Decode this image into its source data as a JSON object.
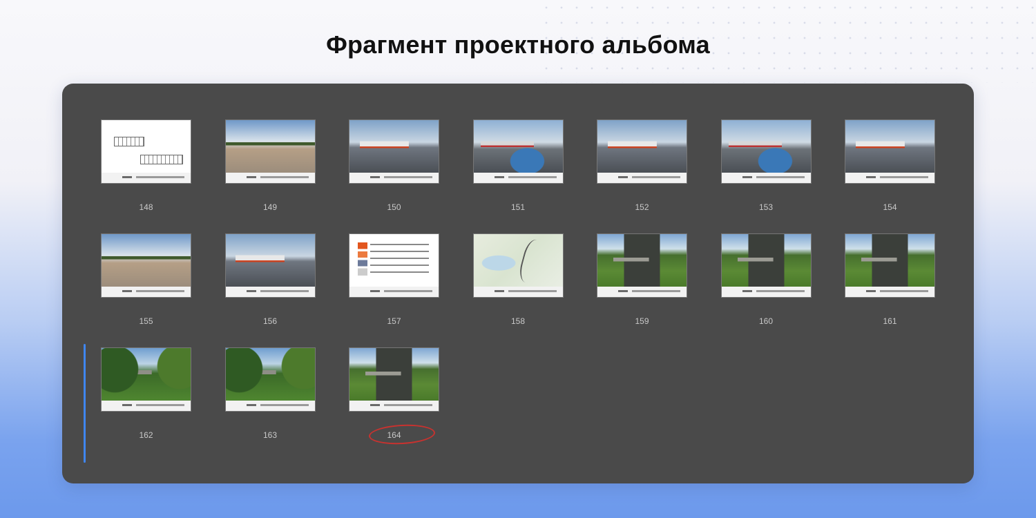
{
  "page_title": "Фрагмент проектного альбома",
  "album": {
    "pages": [
      {
        "label": "148",
        "thumb": "doc"
      },
      {
        "label": "149",
        "thumb": "lot"
      },
      {
        "label": "150",
        "thumb": "station"
      },
      {
        "label": "151",
        "thumb": "water"
      },
      {
        "label": "152",
        "thumb": "station"
      },
      {
        "label": "153",
        "thumb": "water"
      },
      {
        "label": "154",
        "thumb": "station"
      },
      {
        "label": "155",
        "thumb": "lot"
      },
      {
        "label": "156",
        "thumb": "station"
      },
      {
        "label": "157",
        "thumb": "legend"
      },
      {
        "label": "158",
        "thumb": "map"
      },
      {
        "label": "159",
        "thumb": "bridge"
      },
      {
        "label": "160",
        "thumb": "bridge"
      },
      {
        "label": "161",
        "thumb": "bridge"
      },
      {
        "label": "162",
        "thumb": "forest"
      },
      {
        "label": "163",
        "thumb": "forest"
      },
      {
        "label": "164",
        "thumb": "bridge",
        "highlighted": true
      }
    ],
    "highlight_color": "#c8322f",
    "scroll_indicator_color": "#3f86f1"
  }
}
